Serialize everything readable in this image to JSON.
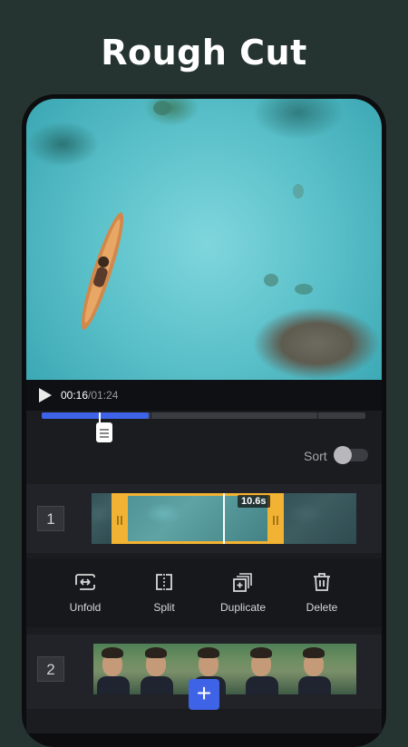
{
  "headline": "Rough Cut",
  "player": {
    "current_time": "00:16",
    "total_time": "/01:24",
    "progress_fraction": 0.33
  },
  "sort": {
    "label": "Sort",
    "enabled": false
  },
  "clips": [
    {
      "index": "1",
      "duration": "10.6s"
    },
    {
      "index": "2"
    }
  ],
  "toolbar": {
    "unfold": "Unfold",
    "split": "Split",
    "duplicate": "Duplicate",
    "delete": "Delete"
  },
  "add_button": "+",
  "colors": {
    "background": "#253431",
    "accent_blue": "#3e63e8",
    "selection_orange": "#f2b233"
  },
  "icons": [
    "play-icon",
    "unfold-icon",
    "split-icon",
    "duplicate-icon",
    "delete-icon",
    "plus-icon"
  ]
}
